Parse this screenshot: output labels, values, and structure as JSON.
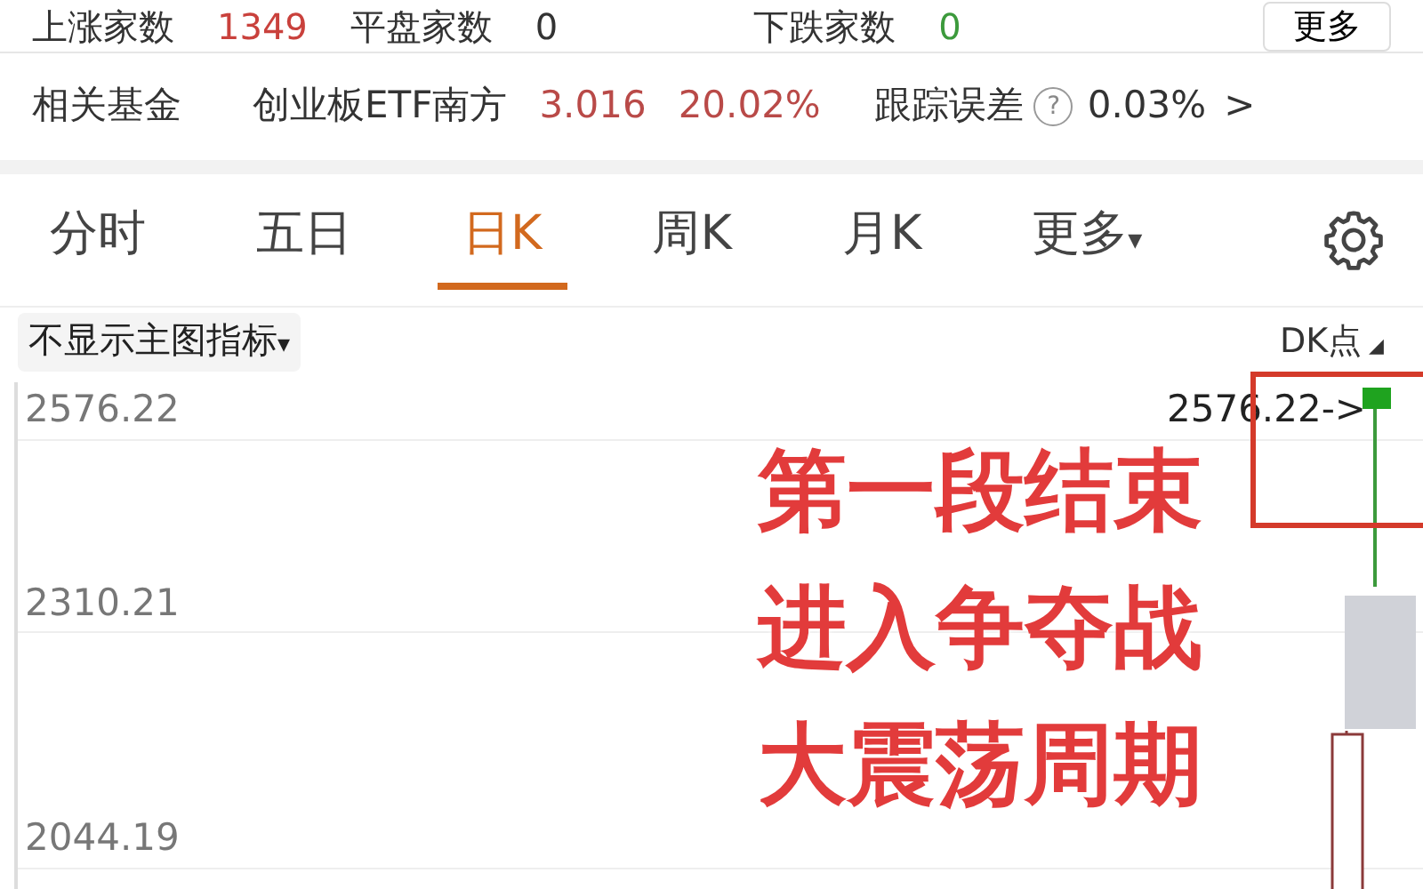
{
  "market_stats": [
    {
      "label": "上涨家数",
      "value": "1349",
      "color": "#c9413c"
    },
    {
      "label": "平盘家数",
      "value": "0",
      "color": "#333333"
    },
    {
      "label": "下跌家数",
      "value": "0",
      "color": "#3c9a3c"
    }
  ],
  "more_button": "更多",
  "related_fund": {
    "label": "相关基金",
    "name": "创业板ETF南方",
    "price": "3.016",
    "change": "20.02%",
    "tracking_label": "跟踪误差",
    "help": "?",
    "tracking_value": "0.03%",
    "chevron": ">"
  },
  "tabs": [
    {
      "label": "分时",
      "selected": false
    },
    {
      "label": "五日",
      "selected": false
    },
    {
      "label": "日K",
      "selected": true
    },
    {
      "label": "周K",
      "selected": false
    },
    {
      "label": "月K",
      "selected": false
    },
    {
      "label": "更多",
      "selected": false,
      "caret": "▾"
    }
  ],
  "indicator_button": {
    "label": "不显示主图指标",
    "caret": "▾"
  },
  "dk_toggle": {
    "label": "DK点",
    "caret": "◢"
  },
  "chart": {
    "y_labels": [
      "2576.22",
      "2310.21",
      "2044.19"
    ],
    "price_marker": "2576.22->"
  },
  "annotation": {
    "lines": [
      "第一段结束",
      "进入争夺战",
      "大震荡周期"
    ]
  }
}
